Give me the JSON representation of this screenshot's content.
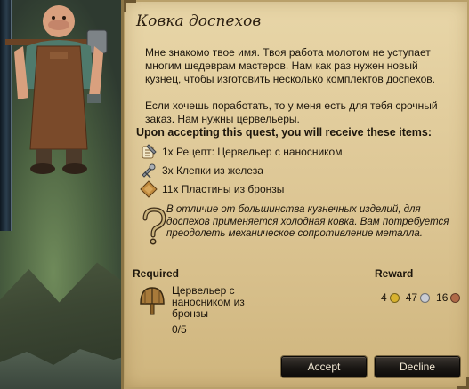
{
  "quest": {
    "title": "Ковка доспехов",
    "description": [
      "Мне знакомо твое имя. Твоя работа молотом не уступает многим шедеврам мастеров. Нам как раз нужен новый кузнец, чтобы изготовить несколько комплектов доспехов.",
      "Если хочешь поработать, то у меня есть для тебя срочный заказ. Нам нужны цервельеры."
    ],
    "receive_heading": "Upon accepting this quest, you will receive these items:",
    "items": [
      {
        "label": "1x Рецепт: Цервельер с наносником",
        "icon": "recipe-scroll-icon"
      },
      {
        "label": "3x Клепки из железа",
        "icon": "iron-rivets-icon"
      },
      {
        "label": "11x Пластины из бронзы",
        "icon": "bronze-plates-icon"
      }
    ],
    "tip": "В отличие от большинства кузнечных изделий, для доспехов применяется холодная ковка. Вам потребуется преодолеть механическое сопротивление металла.",
    "required_heading": "Required",
    "required_item": {
      "name": "Цервельер с наносником из бронзы",
      "progress": "0/5",
      "icon": "cervelliere-helmet-icon"
    },
    "reward_heading": "Reward",
    "reward": {
      "gold": "4",
      "silver": "47",
      "copper": "16",
      "colors": {
        "gold": "#d8b22e",
        "silver": "#c9ccd4",
        "copper": "#b06a48"
      }
    },
    "buttons": {
      "accept": "Accept",
      "decline": "Decline"
    }
  }
}
